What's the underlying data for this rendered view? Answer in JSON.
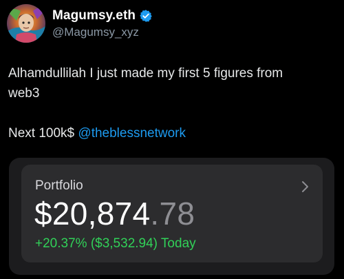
{
  "user": {
    "display_name": "Magumsy.eth",
    "handle": "@Magumsy_xyz"
  },
  "tweet": {
    "line1": "Alhamdullilah I just made my first 5 figures from",
    "line2": "web3",
    "line3_prefix": "Next 100k$ ",
    "mention": "@theblessnetwork"
  },
  "portfolio_card": {
    "label": "Portfolio",
    "balance_main": "$20,874",
    "balance_cents": ".78",
    "change_text": "+20.37% ($3,532.94) Today"
  },
  "colors": {
    "background": "#000000",
    "verified_badge": "#1d9bf0",
    "mention": "#1d9bf0",
    "gain": "#31d158"
  },
  "icons": [
    "avatar",
    "verified-icon",
    "chevron-right-icon"
  ]
}
